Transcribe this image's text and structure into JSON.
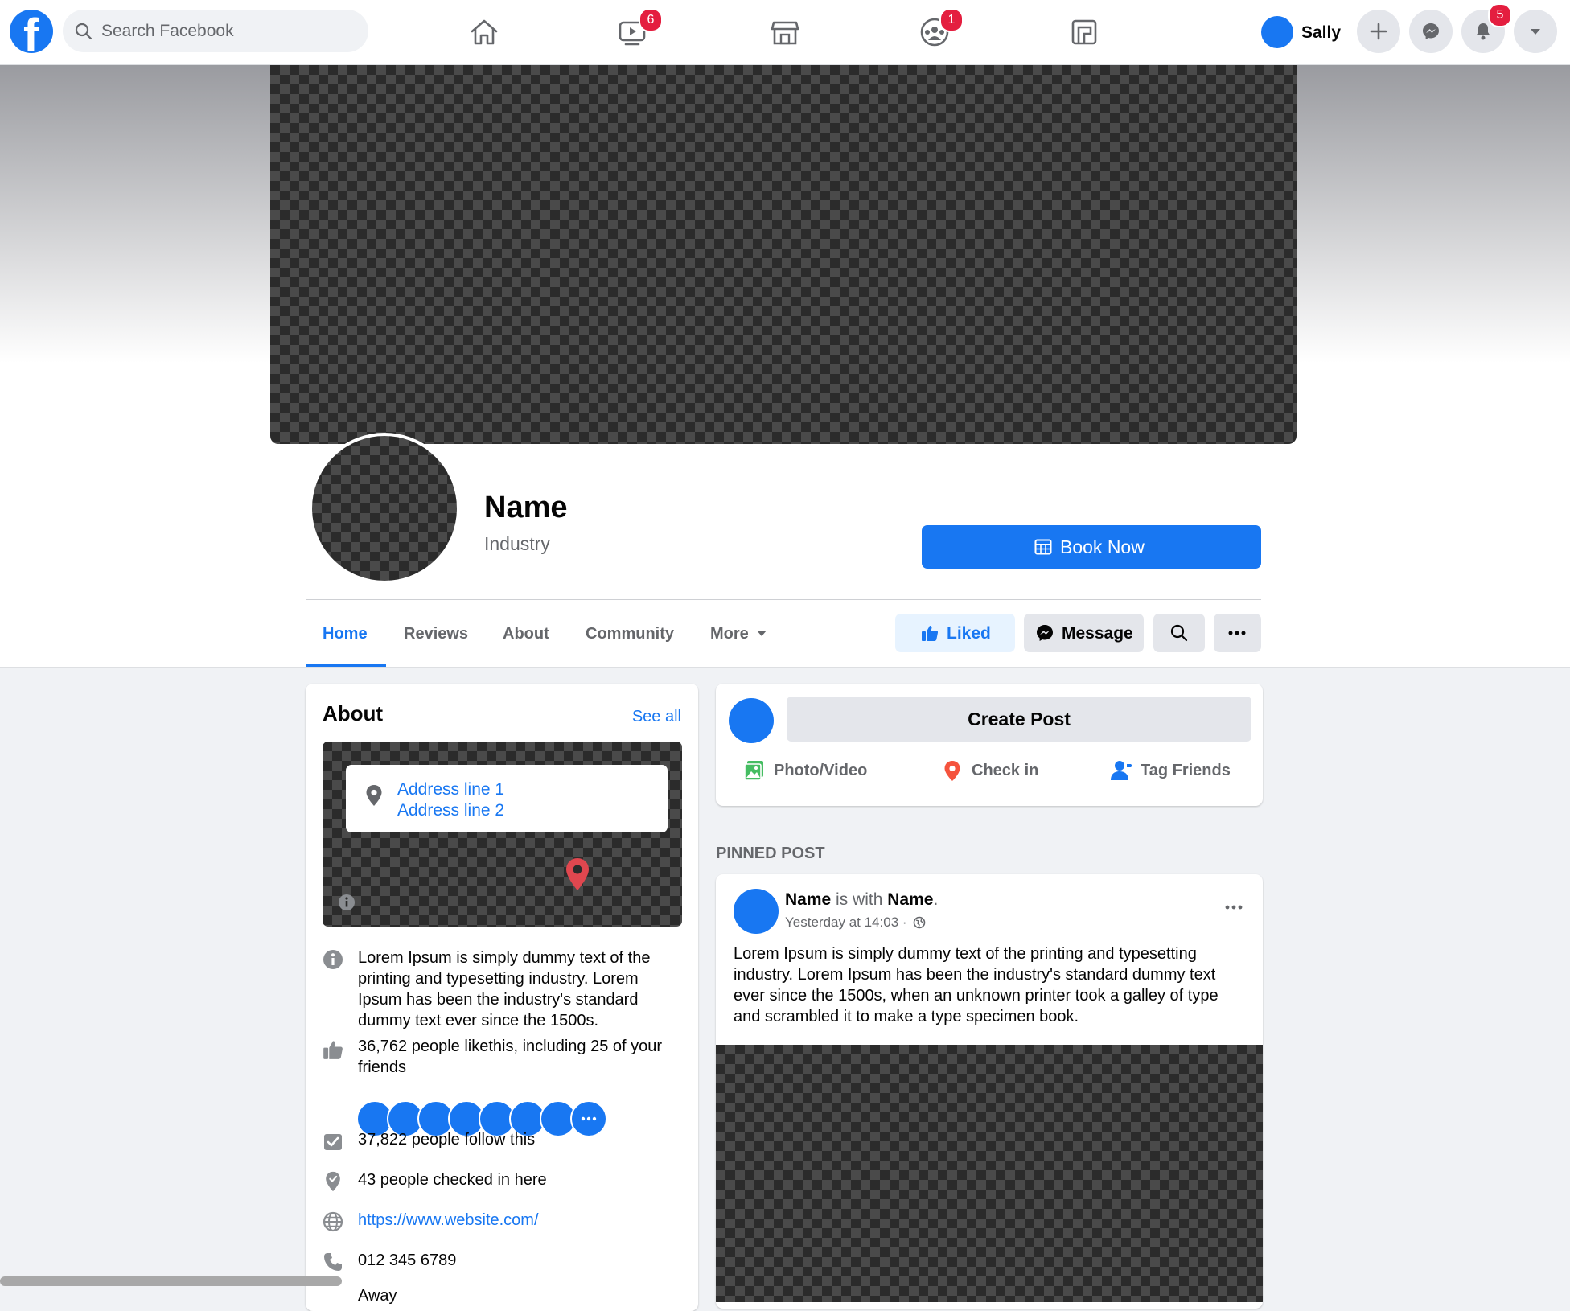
{
  "topbar": {
    "logo": "f",
    "search_placeholder": "Search Facebook",
    "nav": [
      {
        "icon": "home-icon",
        "badge": ""
      },
      {
        "icon": "watch-icon",
        "badge": "6"
      },
      {
        "icon": "marketplace-icon",
        "badge": ""
      },
      {
        "icon": "groups-icon",
        "badge": "1"
      },
      {
        "icon": "gaming-icon",
        "badge": ""
      }
    ],
    "user_name": "Sally",
    "notifications_badge": "5"
  },
  "page": {
    "name": "Name",
    "industry": "Industry",
    "book_label": "Book Now",
    "tabs": [
      "Home",
      "Reviews",
      "About",
      "Community",
      "More"
    ],
    "active_tab": "Home",
    "liked_label": "Liked",
    "message_label": "Message"
  },
  "about": {
    "title": "About",
    "see_all": "See all",
    "address_line_1": "Address line 1",
    "address_line_2": "Address line 2",
    "description": "Lorem Ipsum is simply dummy text of the printing and typesetting industry. Lorem Ipsum has been the industry's standard dummy text ever since the 1500s.",
    "likes": "36,762 people likethis, including 25 of your friends",
    "follows": "37,822 people follow this",
    "checkins": "43 people checked in here",
    "website": "https://www.website.com/",
    "phone": "012 345 6789",
    "away_partial": "Away"
  },
  "composer": {
    "create_post": "Create Post",
    "photo_video": "Photo/Video",
    "check_in": "Check in",
    "tag_friends": "Tag Friends"
  },
  "pinned": {
    "label": "PINNED POST",
    "author": "Name",
    "with_text": "is with",
    "with_name": "Name",
    "period": ".",
    "time": "Yesterday at 14:03 ·",
    "text": "Lorem Ipsum is simply dummy text of the printing and typesetting industry. Lorem Ipsum has been the industry's standard dummy text ever since the 1500s, when an unknown printer took a galley of type and scrambled it to make a type specimen book."
  },
  "colors": {
    "brand_blue": "#1877f2",
    "badge_red": "#e41e3f",
    "background": "#f0f2f5",
    "liked_bg": "#e7f3ff"
  }
}
